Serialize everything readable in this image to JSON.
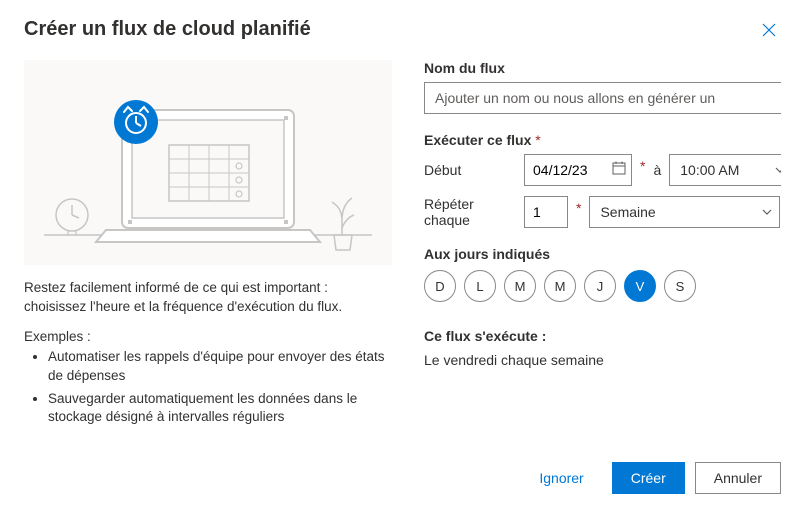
{
  "header": {
    "title": "Créer un flux de cloud planifié"
  },
  "left": {
    "description": "Restez facilement informé de ce qui est important : choisissez l'heure et la fréquence d'exécution du flux.",
    "examples_label": "Exemples :",
    "examples": [
      "Automatiser les rappels d'équipe pour envoyer des états de dépenses",
      "Sauvegarder automatiquement les données dans le stockage désigné à intervalles réguliers"
    ]
  },
  "form": {
    "flow_name_label": "Nom du flux",
    "flow_name_placeholder": "Ajouter un nom ou nous allons en générer un",
    "flow_name_value": "",
    "run_label": "Exécuter ce flux",
    "start_label": "Début",
    "start_date": "04/12/23",
    "at_label": "à",
    "start_time": "10:00 AM",
    "repeat_label": "Répéter chaque",
    "repeat_count": "1",
    "repeat_unit": "Semaine",
    "days_label": "Aux jours indiqués",
    "days": [
      {
        "abbr": "D",
        "selected": false
      },
      {
        "abbr": "L",
        "selected": false
      },
      {
        "abbr": "M",
        "selected": false
      },
      {
        "abbr": "M",
        "selected": false
      },
      {
        "abbr": "J",
        "selected": false
      },
      {
        "abbr": "V",
        "selected": true
      },
      {
        "abbr": "S",
        "selected": false
      }
    ],
    "exec_heading": "Ce flux s'exécute :",
    "exec_text": "Le vendredi chaque semaine"
  },
  "footer": {
    "skip": "Ignorer",
    "create": "Créer",
    "cancel": "Annuler"
  },
  "icons": {
    "calendar": "calendar-icon",
    "clock": "clock-icon",
    "chevron": "chevron-down-icon",
    "close": "close-icon"
  },
  "colors": {
    "primary": "#0078d4",
    "required": "#a4262c"
  }
}
